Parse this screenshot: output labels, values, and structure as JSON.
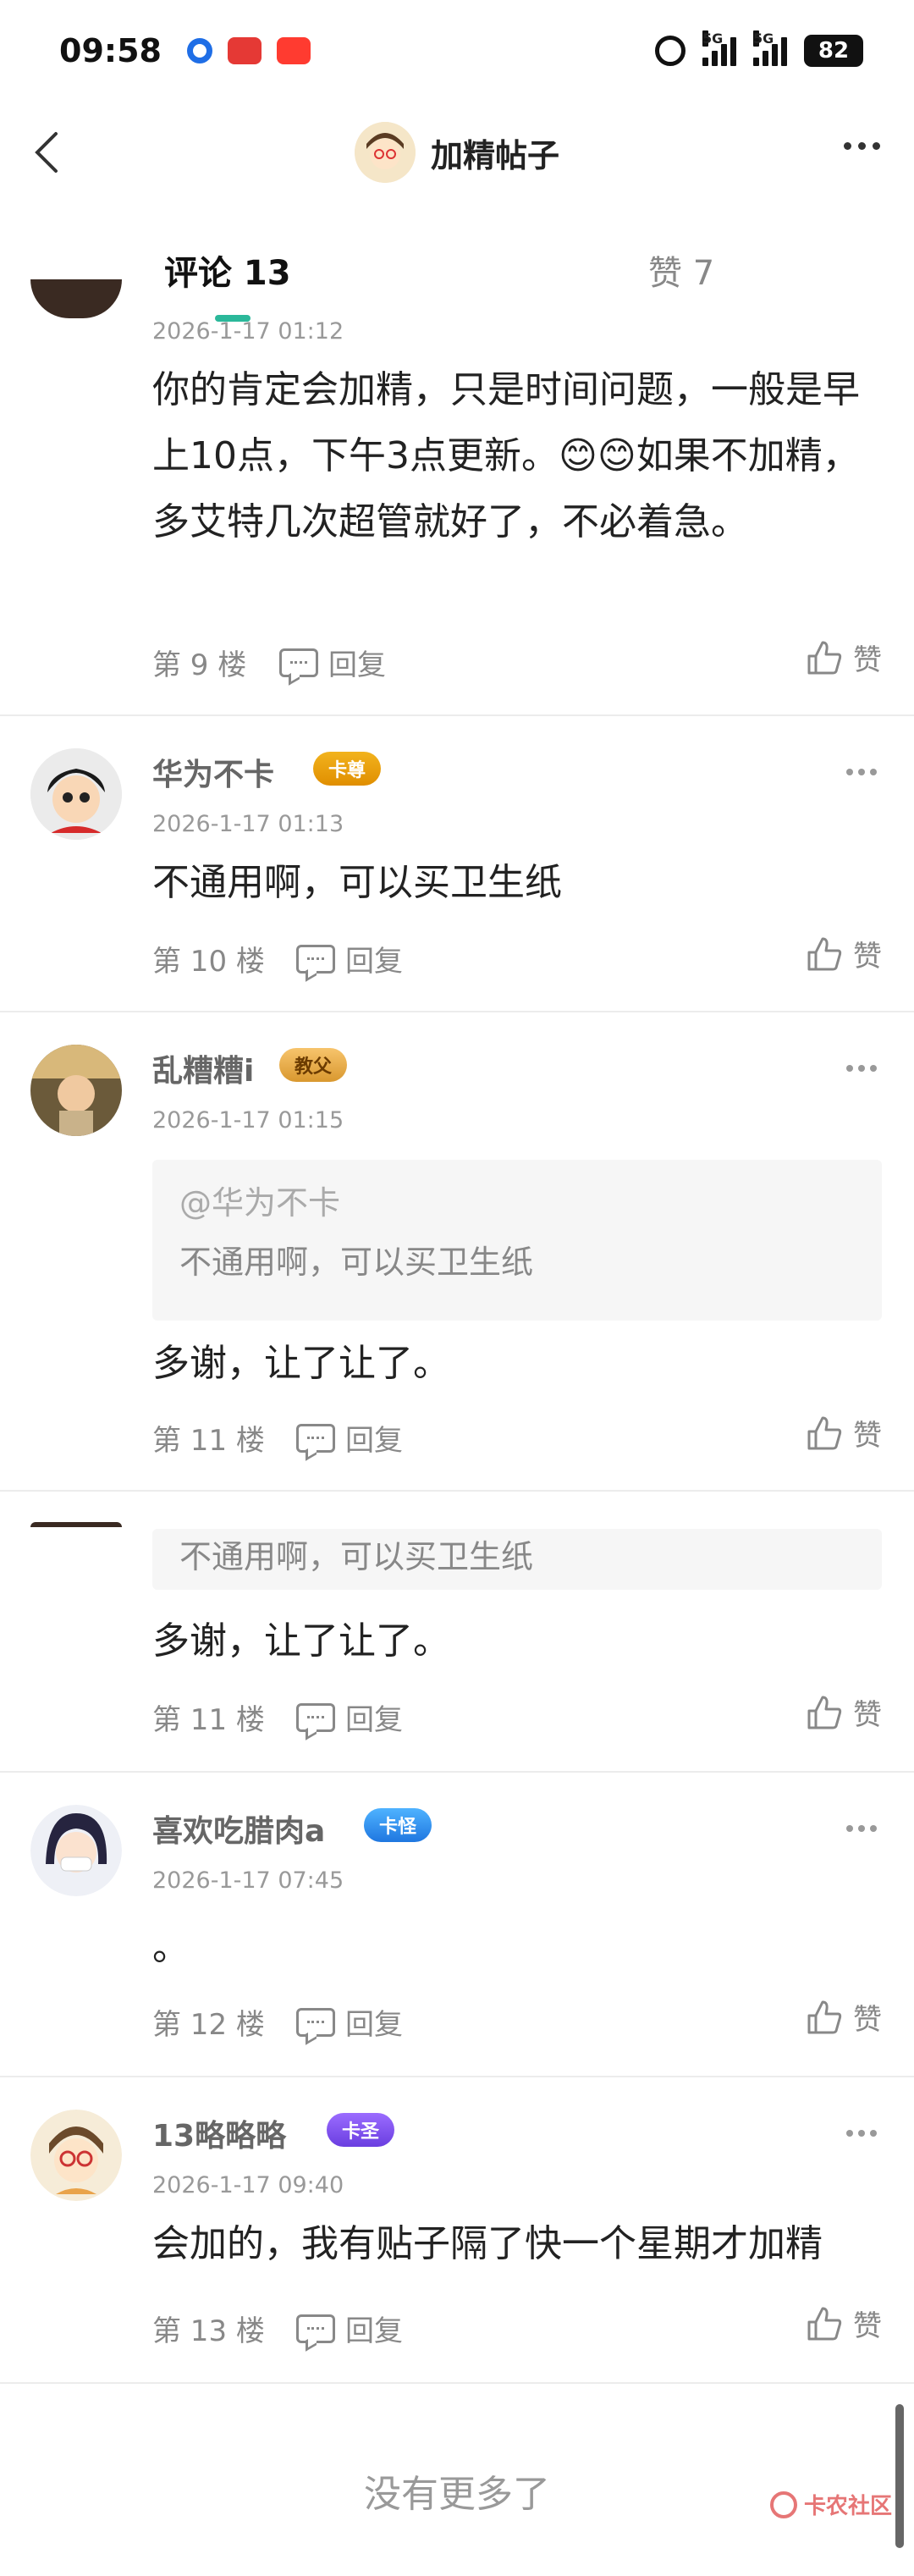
{
  "status_bar": {
    "time": "09:58",
    "battery": "82",
    "network_labels": [
      "5G",
      "5G"
    ]
  },
  "nav": {
    "title": "加精帖子"
  },
  "tabs": [
    {
      "label": "评论 13",
      "active": true
    },
    {
      "label": "赞 7",
      "active": false
    }
  ],
  "comments": [
    {
      "time": "2026-1-17 01:12",
      "content": "你的肯定会加精，只是时间问题，一般是早上10点，下午3点更新。😊😊如果不加精，多艾特几次超管就好了，不必着急。",
      "floor": "第 9 楼",
      "reply": "回复",
      "like": "赞"
    },
    {
      "username": "华为不卡",
      "badge": "卡尊",
      "time": "2026-1-17 01:13",
      "content": "不通用啊，可以买卫生纸",
      "floor": "第 10 楼",
      "reply": "回复",
      "like": "赞"
    },
    {
      "username": "乱糟糟i",
      "badge": "教父",
      "time": "2026-1-17 01:15",
      "quote_user": "@华为不卡",
      "quote_text": "不通用啊，可以买卫生纸",
      "content": "多谢，让了让了。",
      "floor": "第 11 楼",
      "reply": "回复",
      "like": "赞"
    },
    {
      "quote_text": "不通用啊，可以买卫生纸",
      "content": "多谢，让了让了。",
      "floor": "第 11 楼",
      "reply": "回复",
      "like": "赞"
    },
    {
      "username": "喜欢吃腊肉a",
      "badge": "卡怪",
      "time": "2026-1-17 07:45",
      "content": "。",
      "floor": "第 12 楼",
      "reply": "回复",
      "like": "赞"
    },
    {
      "username": "13略略略",
      "badge": "卡圣",
      "time": "2026-1-17 09:40",
      "content": "会加的，我有贴子隔了快一个星期才加精",
      "floor": "第 13 楼",
      "reply": "回复",
      "like": "赞"
    }
  ],
  "footer": {
    "no_more": "没有更多了",
    "watermark": "卡农社区"
  }
}
